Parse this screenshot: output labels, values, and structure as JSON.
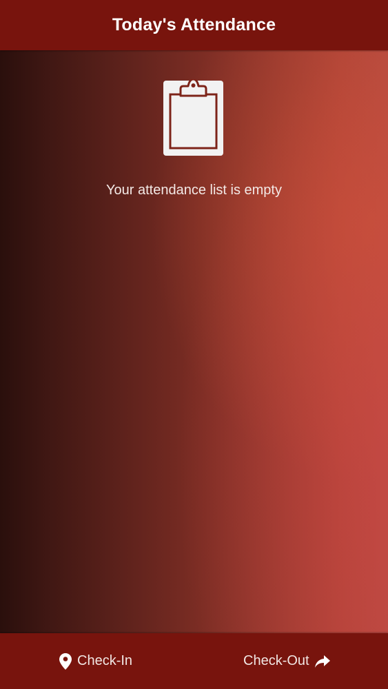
{
  "header": {
    "title": "Today's Attendance"
  },
  "main": {
    "empty_icon": "clipboard-icon",
    "empty_message": "Your attendance list is empty"
  },
  "footer": {
    "check_in": {
      "label": "Check-In",
      "icon": "map-pin-icon"
    },
    "check_out": {
      "label": "Check-Out",
      "icon": "share-arrow-icon"
    }
  },
  "colors": {
    "bar": "#78140d",
    "text": "#ffffff",
    "background_dark": "#2a0f0c",
    "background_light": "#b54a40"
  }
}
